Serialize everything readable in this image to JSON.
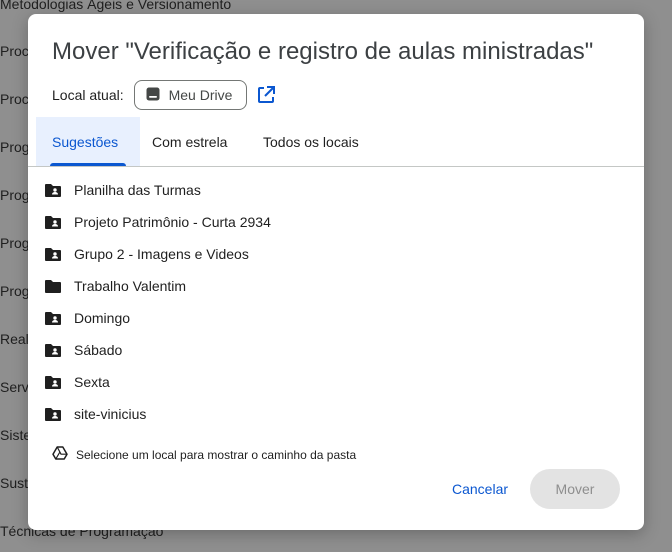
{
  "background": {
    "title": "Metodologias Ágeis e Versionamento",
    "items": [
      "Proc",
      "Proc",
      "Prog",
      "Prog",
      "Prog",
      "Prog",
      "Real",
      "Serv",
      "Siste",
      "Suste"
    ],
    "bottom": "Técnicas de Programação"
  },
  "dialog": {
    "title": "Mover \"Verificação e registro de aulas ministradas\"",
    "location_label": "Local atual:",
    "location_value": "Meu Drive",
    "tabs": [
      {
        "label": "Sugestões",
        "active": true
      },
      {
        "label": "Com estrela",
        "active": false
      },
      {
        "label": "Todos os locais",
        "active": false
      }
    ],
    "folders": [
      {
        "name": "Planilha das Turmas",
        "shared": true
      },
      {
        "name": "Projeto Patrimônio - Curta 2934",
        "shared": true
      },
      {
        "name": "Grupo 2 - Imagens e Videos",
        "shared": true
      },
      {
        "name": "Trabalho Valentim",
        "shared": false
      },
      {
        "name": "Domingo",
        "shared": true
      },
      {
        "name": "Sábado",
        "shared": true
      },
      {
        "name": "Sexta",
        "shared": true
      },
      {
        "name": "site-vinicius",
        "shared": true
      }
    ],
    "hint": "Selecione um local para mostrar o caminho da pasta",
    "cancel_label": "Cancelar",
    "move_label": "Mover"
  },
  "colors": {
    "accent": "#0b57d0",
    "tab_active_bg": "#e8f0fe",
    "disabled_bg": "#e3e3e3",
    "overlay": "#8f8f8f"
  }
}
